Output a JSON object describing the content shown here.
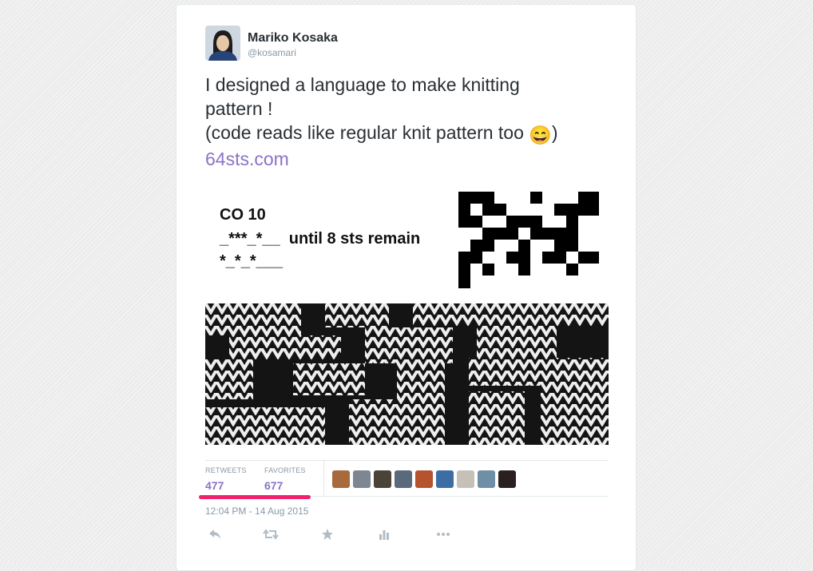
{
  "tweet": {
    "author_name": "Mariko Kosaka",
    "author_handle": "@kosamari",
    "text_lines": [
      "I designed a language to make knitting",
      "pattern !",
      "(code reads like regular knit pattern too",
      ")"
    ],
    "emoji": "😄",
    "link_text": "64sts.com",
    "timestamp": "12:04 PM - 14 Aug 2015"
  },
  "pattern_image": {
    "code_lines": [
      "CO 10",
      "_***_*__  until 8 sts remain",
      "*_*_*___"
    ]
  },
  "stats": {
    "retweets_label": "RETWEETS",
    "retweets_value": "477",
    "favorites_label": "FAVORITES",
    "favorites_value": "677"
  },
  "actions": [
    "reply-icon",
    "retweet-icon",
    "favorite-icon",
    "analytics-icon",
    "more-icon"
  ],
  "colors": {
    "link": "#8a73c6",
    "highlight_underline": "#f0226c",
    "name": "#292f33",
    "muted": "#8899a6"
  }
}
